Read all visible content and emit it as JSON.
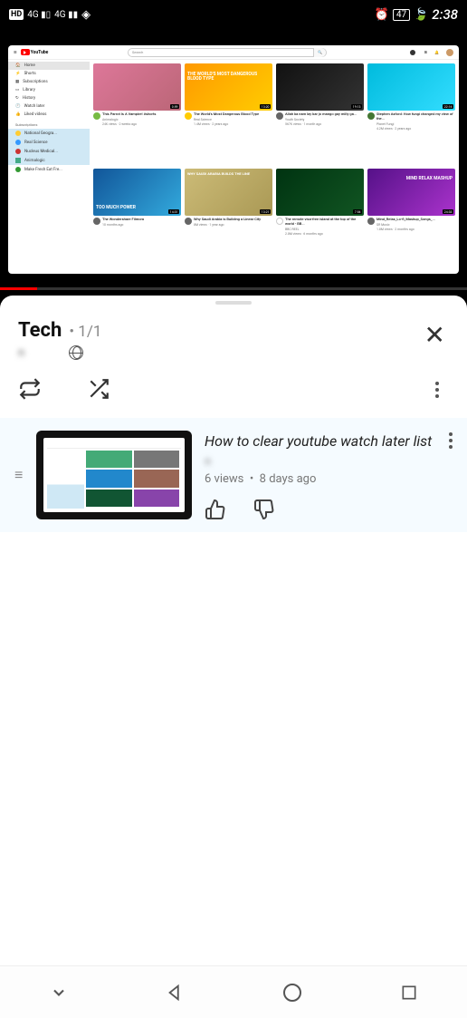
{
  "status": {
    "hd": "HD",
    "net1": "4G",
    "net2": "4G",
    "battery": "47",
    "time": "2:38"
  },
  "youtube": {
    "search_placeholder": "Search",
    "sidebar": {
      "home": "Home",
      "shorts": "Shorts",
      "subscriptions": "Subscriptions",
      "library": "Library",
      "history": "History",
      "watch_later": "Watch later",
      "liked": "Liked videos",
      "subs_header": "Subscriptions",
      "subs": [
        "National Geogra...",
        "Real Science",
        "Nucleus Medical...",
        "Animalogic",
        "Make Fresh Eat Fre..."
      ]
    },
    "videos": [
      {
        "title": "This Parrot Is A Vampire! #shorts",
        "channel": "Animalogic",
        "meta": "24K views · 2 weeks ago",
        "dur": "0:59"
      },
      {
        "title": "The World's Most Dangerous Blood Type",
        "channel": "Real Science",
        "meta": "1.4M views · 2 years ago",
        "dur": "13:20",
        "overlay": "THE WORLD'S MOST DANGEROUS BLOOD TYPE"
      },
      {
        "title": "Allah ka nam lay kar jo mango gay milly ga...",
        "channel": "Youth Society",
        "meta": "567K views · 1 month ago",
        "dur": "19:13"
      },
      {
        "title": "Stephen Axford: How fungi changed my view of the...",
        "channel": "Planet Fungi",
        "meta": "4.2M views · 2 years ago",
        "dur": "22:16"
      },
      {
        "title": "The Wondershare Filmora",
        "channel": "",
        "meta": "10 months ago",
        "dur": "14:31",
        "overlay": "TOO MUCH POWER"
      },
      {
        "title": "Why Saudi Arabia is Building a Linear City",
        "channel": "",
        "meta": "8M views · 1 year ago",
        "dur": "13:21",
        "overlay": "WHY SAUDI ARABIA BUILDS THE LINE"
      },
      {
        "title": "The remote visa-free island at the top of the world - BB...",
        "channel": "BBC REEL",
        "meta": "2.8M views · 6 months ago",
        "dur": "7:54"
      },
      {
        "title": "Mind_Relax_Lo-fi_Mashup_Songs_...",
        "channel": "SR Music",
        "meta": "1.8M views · 2 months ago",
        "dur": "24:33",
        "overlay": "MIND RELAX MASHUP"
      }
    ]
  },
  "playlist": {
    "name": "Tech",
    "position": "1/1",
    "author_hidden": "n",
    "items": [
      {
        "title": "How to clear youtube watch later list",
        "author": "n",
        "views": "6 views",
        "age": "8 days ago"
      }
    ]
  }
}
